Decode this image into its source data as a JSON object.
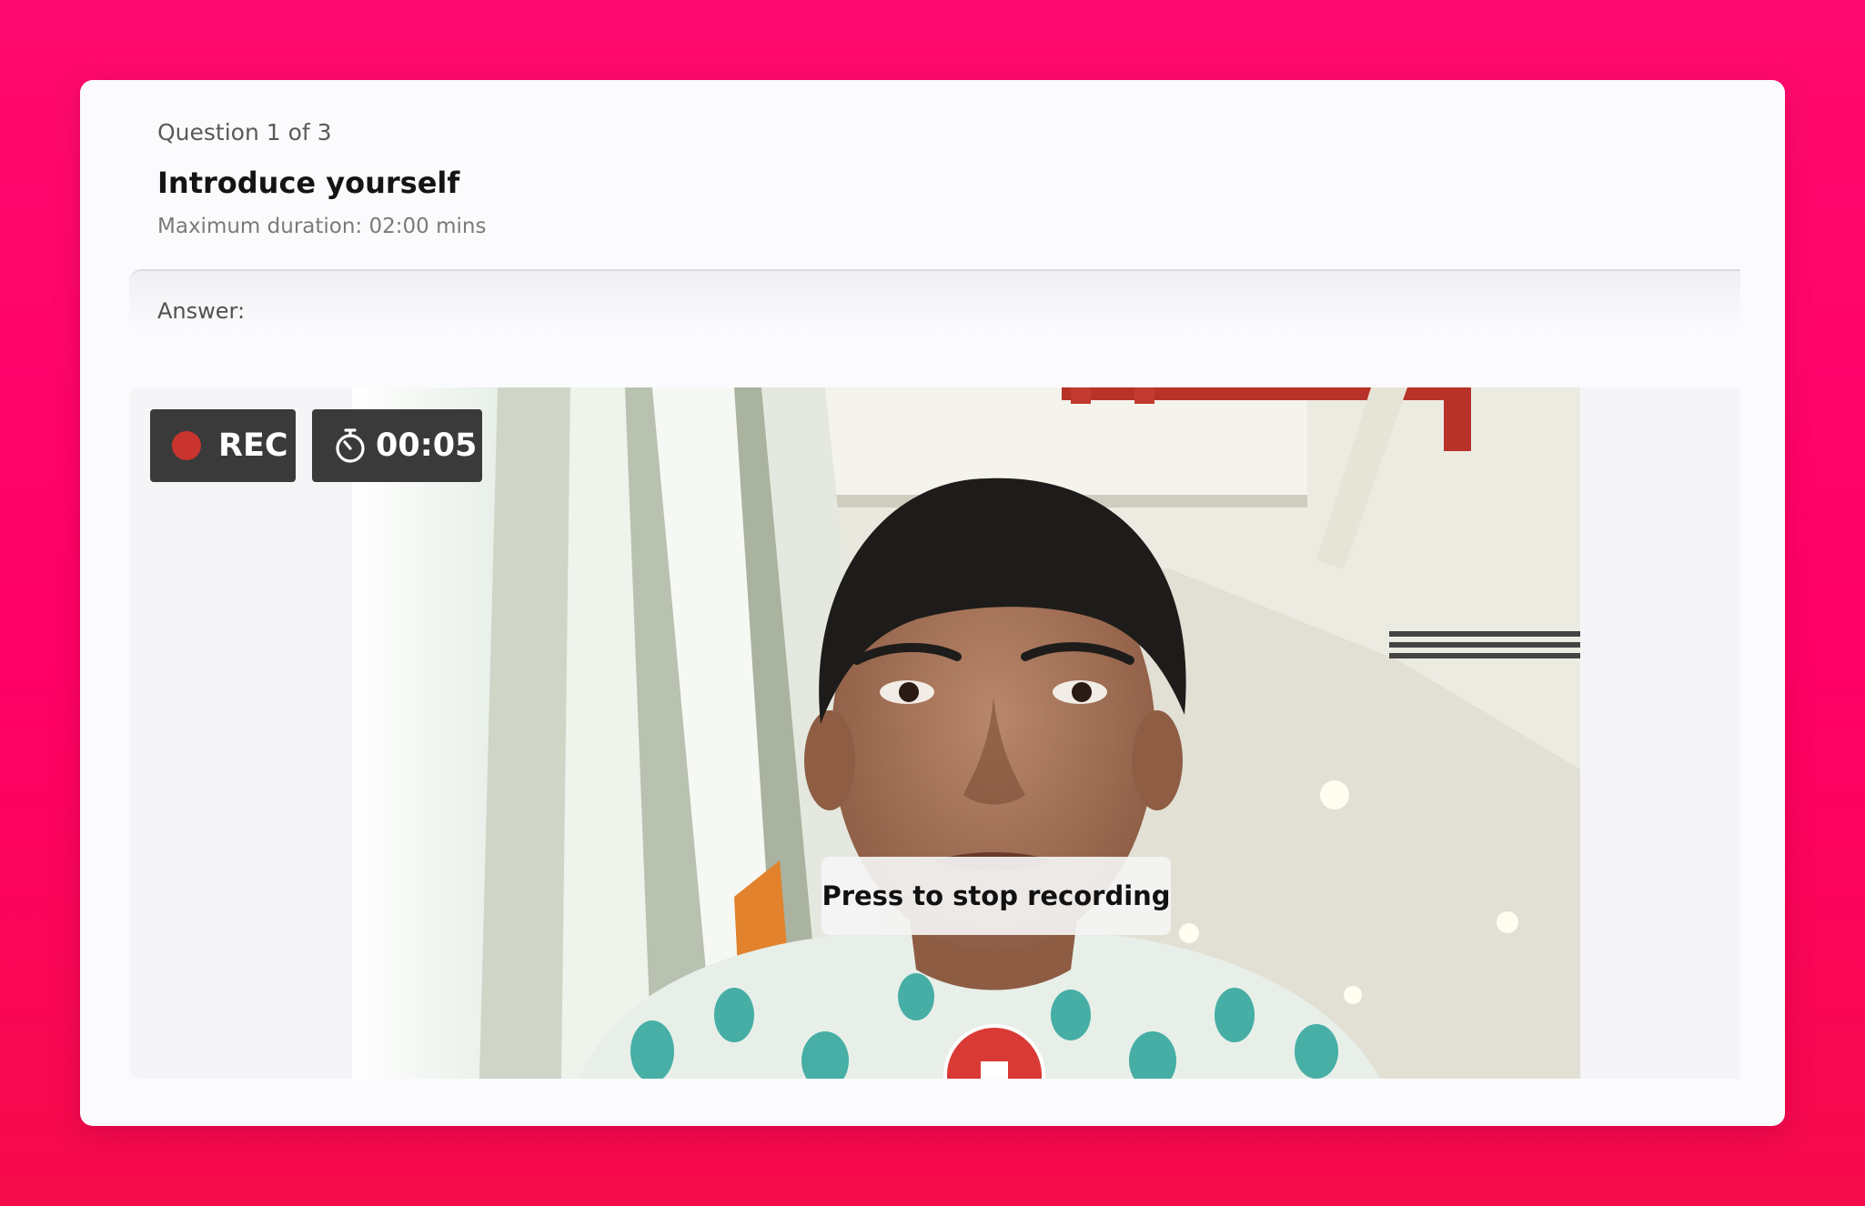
{
  "question": {
    "counter": "Question 1 of 3",
    "title": "Introduce yourself",
    "duration": "Maximum duration: 02:00 mins"
  },
  "answer": {
    "label": "Answer:"
  },
  "recording": {
    "rec_label": "REC",
    "timer": "00:05",
    "stop_tooltip": "Press to stop recording"
  },
  "icons": {
    "rec_indicator": "record-dot-icon",
    "timer": "stopwatch-icon",
    "stop": "stop-square-icon"
  },
  "colors": {
    "background": "#ff0a6e",
    "card": "#fbfbfd",
    "rec_dot": "#c9342f",
    "stop_button": "#d93a35",
    "badge": "#3a3a3a"
  }
}
